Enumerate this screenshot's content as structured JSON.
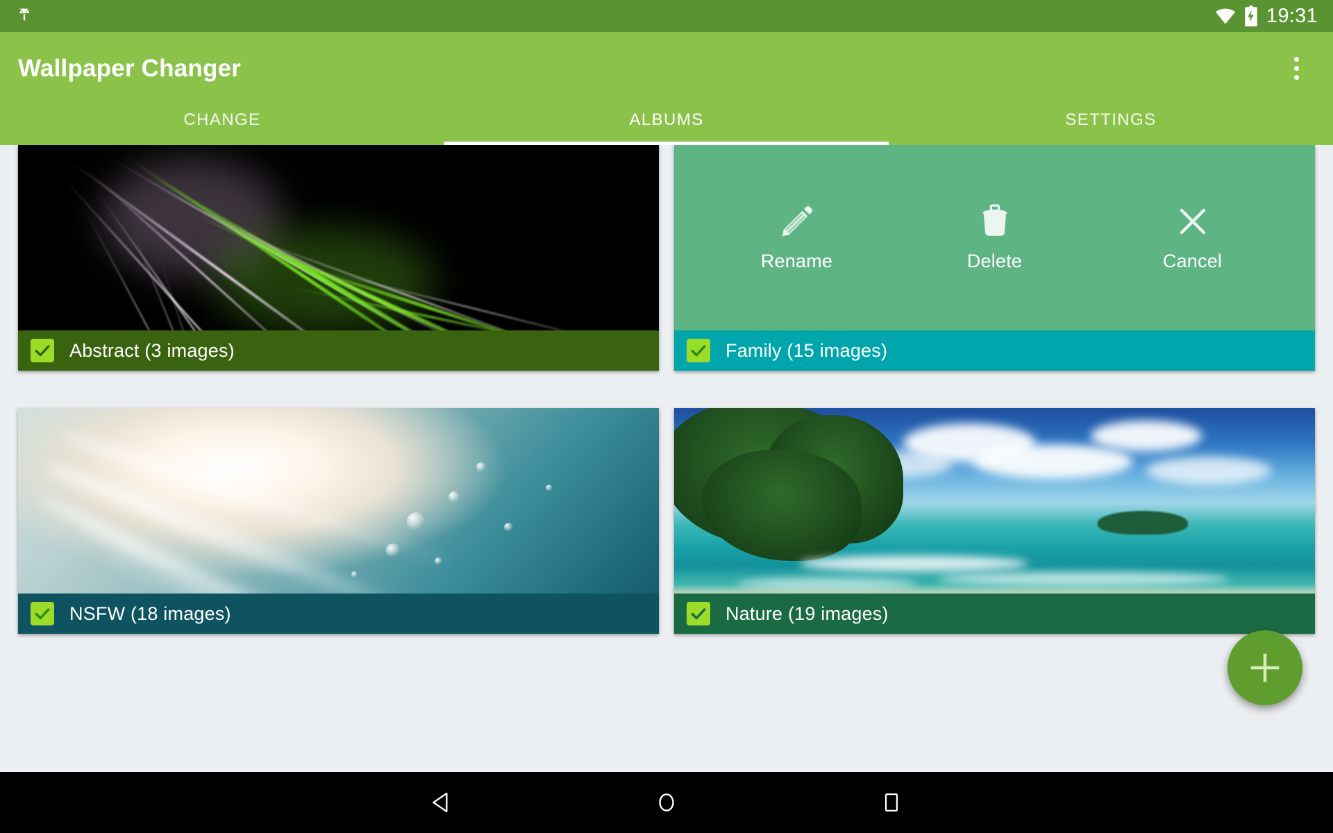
{
  "status_bar": {
    "android_icon": "android-head-icon",
    "wifi_icon": "wifi-icon",
    "battery_icon": "battery-charging-icon",
    "time": "19:31",
    "background": "#5a9432"
  },
  "app_bar": {
    "title": "Wallpaper Changer",
    "overflow_icon": "overflow-menu-icon",
    "background": "#8bc34a"
  },
  "tabs": {
    "active_index": 1,
    "items": [
      {
        "label": "CHANGE"
      },
      {
        "label": "ALBUMS"
      },
      {
        "label": "SETTINGS"
      }
    ]
  },
  "albums": [
    {
      "name": "Abstract",
      "count_label": "(3 images)",
      "caption": "Abstract (3 images)",
      "caption_background": "#3a6310",
      "checked": true,
      "thumb": "abstract-fractal-thumbnail",
      "selected": false
    },
    {
      "name": "Family",
      "count_label": "(15 images)",
      "caption": "Family (15 images)",
      "caption_background": "#01a6ad",
      "checked": true,
      "thumb": "family-thumbnail",
      "selected": true
    },
    {
      "name": "NSFW",
      "count_label": "(18 images)",
      "caption": "NSFW (18 images)",
      "caption_background": "#0f5360",
      "checked": true,
      "thumb": "nsfw-light-rays-thumbnail",
      "selected": false
    },
    {
      "name": "Nature",
      "count_label": "(19 images)",
      "caption": "Nature (19 images)",
      "caption_background": "#1a6b44",
      "checked": true,
      "thumb": "nature-beach-thumbnail",
      "selected": false
    }
  ],
  "action_overlay": {
    "background": "#5fb484",
    "actions": [
      {
        "label": "Rename",
        "icon": "pencil-icon"
      },
      {
        "label": "Delete",
        "icon": "trash-icon"
      },
      {
        "label": "Cancel",
        "icon": "close-icon"
      }
    ]
  },
  "fab": {
    "icon": "plus-icon",
    "color": "#5f9d2e"
  },
  "nav_bar": {
    "background": "#000000",
    "buttons": [
      {
        "icon": "back-triangle-icon"
      },
      {
        "icon": "home-circle-icon"
      },
      {
        "icon": "recents-square-icon"
      }
    ]
  },
  "colors": {
    "accent": "#8bc34a",
    "status_bar": "#5a9432",
    "checkbox": "#9bdc28",
    "page_background": "#eceff1"
  }
}
